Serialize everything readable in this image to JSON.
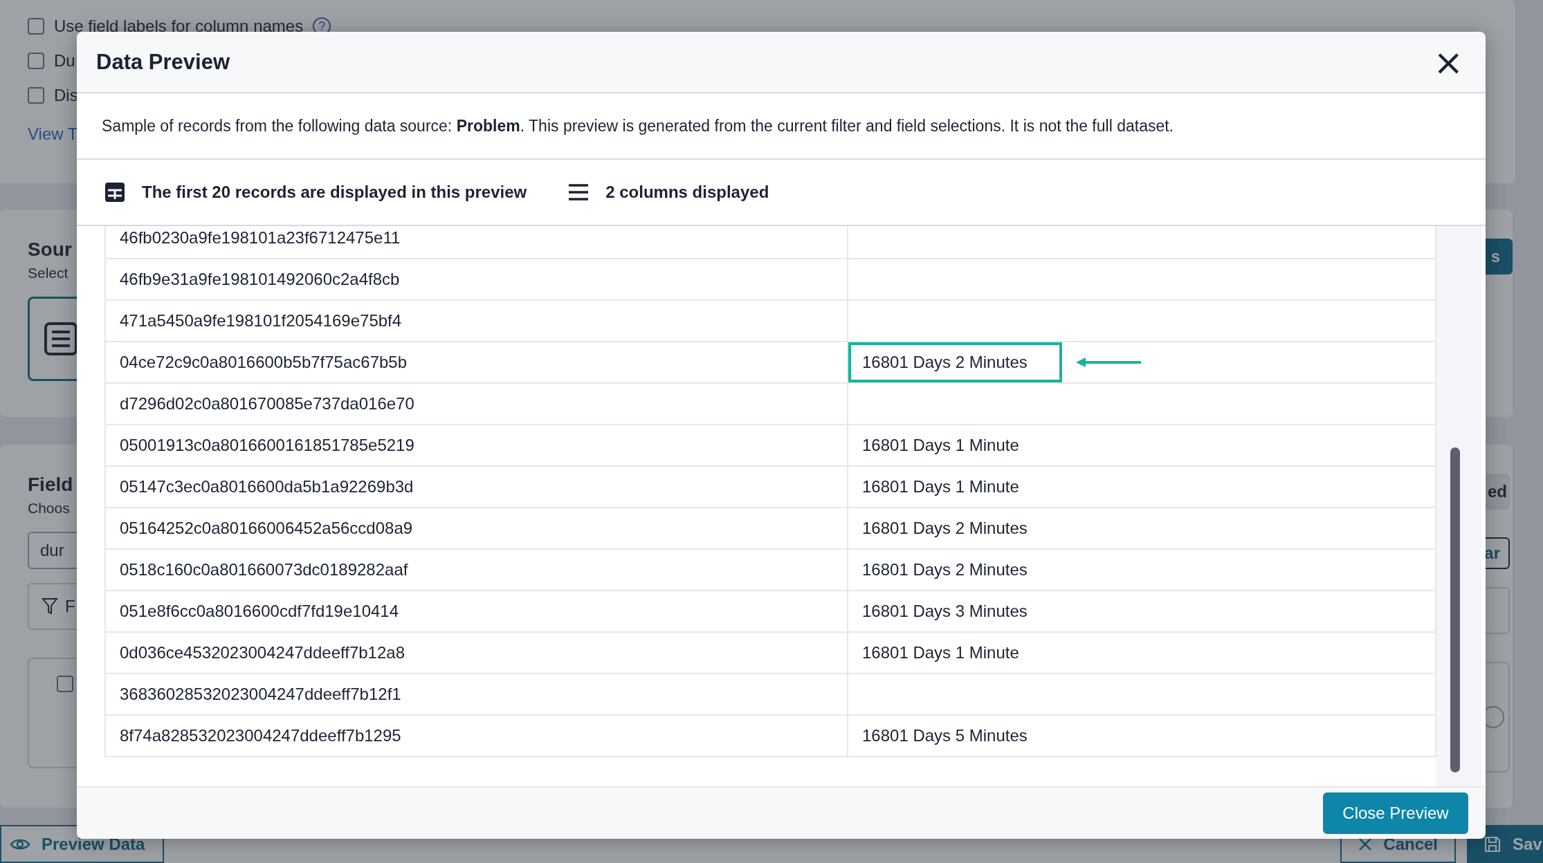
{
  "background": {
    "options": [
      {
        "label": "Use field labels for column names",
        "checked": false,
        "help": "?"
      },
      {
        "label": "Du",
        "checked": false
      },
      {
        "label": "Dis",
        "checked": false
      }
    ],
    "link": "View T",
    "source": {
      "title": "Sour",
      "subtitle": "Select",
      "button": "s"
    },
    "fields": {
      "title": "Field",
      "subtitle": "Choos",
      "search_value": "dur",
      "filter_button": "F",
      "badge": "ed",
      "clear_button": "ar",
      "field_checked": false,
      "radio_checked": false
    },
    "footer": {
      "preview_button": "Preview Data",
      "cancel_button": "Cancel",
      "save_button": "Sav"
    }
  },
  "dialog": {
    "title": "Data Preview",
    "close": "×",
    "description": "Sample of records from the following data source: **Problem**. This preview is generated from the current filter and field selections. It is not the full dataset.",
    "records_info": "The first 20 records are displayed in this preview",
    "columns_info": "2 columns displayed",
    "table": {
      "rows": [
        {
          "column_1": "46fb0230a9fe198101a23f6712475e11",
          "highlighted": false
        },
        {
          "column_1": "46fb9e31a9fe198101492060c2a4f8cb",
          "highlighted": false
        },
        {
          "column_1": "471a5450a9fe198101f2054169e75bf4",
          "highlighted": false
        },
        {
          "column_1": "04ce72c9c0a8016600b5b7f75ac67b5b",
          "column_2": "16801 Days 2 Minutes",
          "highlighted": true
        },
        {
          "column_1": "d7296d02c0a801670085e737da016e70",
          "highlighted": false
        },
        {
          "column_1": "05001913c0a8016600161851785e5219",
          "column_2": "16801 Days 1 Minute",
          "highlighted": false
        },
        {
          "column_1": "05147c3ec0a8016600da5b1a92269b3d",
          "column_2": "16801 Days 1 Minute",
          "highlighted": false
        },
        {
          "column_1": "05164252c0a80166006452a56ccd08a9",
          "column_2": "16801 Days 2 Minutes",
          "highlighted": false
        },
        {
          "column_1": "0518c160c0a801660073dc0189282aaf",
          "column_2": "16801 Days 2 Minutes",
          "highlighted": false
        },
        {
          "column_1": "051e8f6cc0a8016600cdf7fd19e10414",
          "column_2": "16801 Days 3 Minutes",
          "highlighted": false
        },
        {
          "column_1": "0d036ce4532023004247ddeeff7b12a8",
          "column_2": "16801 Days 1 Minute",
          "highlighted": false
        },
        {
          "column_1": "36836028532023004247ddeeff7b12f1",
          "highlighted": false
        },
        {
          "column_1": "8f74a828532023004247ddeeff7b1295",
          "column_2": "16801 Days 5 Minutes",
          "highlighted": false
        }
      ]
    },
    "close_button": "Close Preview"
  }
}
